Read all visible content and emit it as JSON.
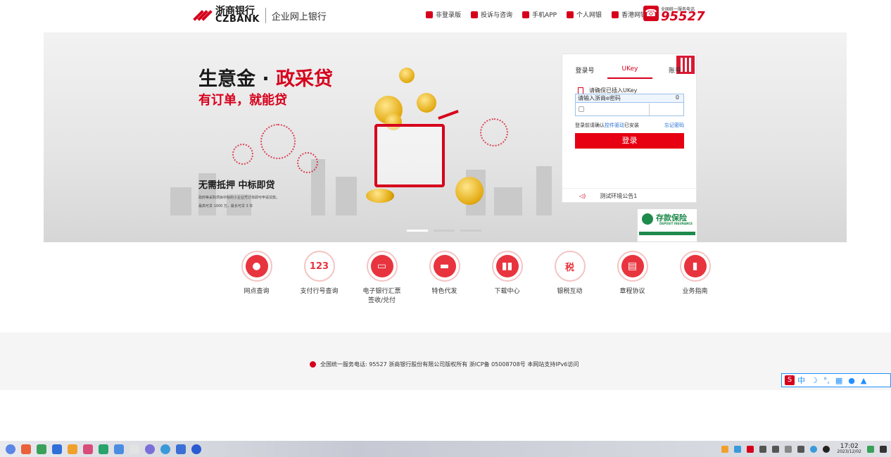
{
  "header": {
    "logo_cn": "浙商银行",
    "logo_en": "CZBANK",
    "logo_sub": "企业网上银行",
    "nav": [
      {
        "label": "非登录版",
        "icon": "home-icon"
      },
      {
        "label": "投诉与咨询",
        "icon": "message-icon"
      },
      {
        "label": "手机APP",
        "icon": "mobile-icon"
      },
      {
        "label": "个人网银",
        "icon": "monitor-icon"
      },
      {
        "label": "香港网银",
        "icon": "monitor-icon"
      }
    ],
    "hotline_caption": "全国统一服务电话",
    "hotline": "95527"
  },
  "banner": {
    "title_black": "生意金 · ",
    "title_red": "政采贷",
    "subtitle": "有订单，就能贷",
    "tagline": "无需抵押  中标即贷",
    "desc_line1": "政府等采购项目中标的小企业凭订单即可申请贷款。",
    "desc_line2": "最高可贷 1000 万，最长可贷 3 年"
  },
  "login": {
    "tabs": [
      "登录号",
      "UKey",
      "账号"
    ],
    "active_tab": "UKey",
    "ukey_hint": "请确保已插入UKey",
    "password_placeholder": "请输入浙商e密码",
    "password_count": "0",
    "hint_prefix": "登录前请确认",
    "hint_link": "控件驱动",
    "hint_suffix": "已安装",
    "forgot_link": "忘记密码",
    "login_button": "登录",
    "notice": "测试环境公告1"
  },
  "deposit": {
    "cn": "存款保险",
    "en": "DEPOSIT INSURANCE"
  },
  "quick_links": [
    {
      "label": "网点查询",
      "icon": "location-icon",
      "glyph": "⬤"
    },
    {
      "label": "支付行号查询",
      "icon": "number-icon",
      "glyph": "123"
    },
    {
      "label": "电子银行汇票\n签收/兑付",
      "icon": "ticket-icon",
      "glyph": "▭"
    },
    {
      "label": "特色代发",
      "icon": "card-icon",
      "glyph": "▬"
    },
    {
      "label": "下载中心",
      "icon": "book-icon",
      "glyph": "▮▮"
    },
    {
      "label": "银税互动",
      "icon": "tax-icon",
      "glyph": "税"
    },
    {
      "label": "章程协议",
      "icon": "document-icon",
      "glyph": "▤"
    },
    {
      "label": "业务指南",
      "icon": "bookmark-icon",
      "glyph": "▮"
    }
  ],
  "footer": {
    "text": "全国统一服务电话: 95527   浙商银行股份有限公司版权所有 浙ICP备 05008708号 本网站支持IPv6访问"
  },
  "ime": {
    "logo": "S",
    "lang": "中"
  },
  "taskbar": {
    "time": "17:02",
    "date": "2023/12/02"
  },
  "colors": {
    "brand_red": "#d6001c",
    "button_red": "#e60012",
    "link_blue": "#1f6fd1",
    "deposit_green": "#1e8a4c"
  }
}
